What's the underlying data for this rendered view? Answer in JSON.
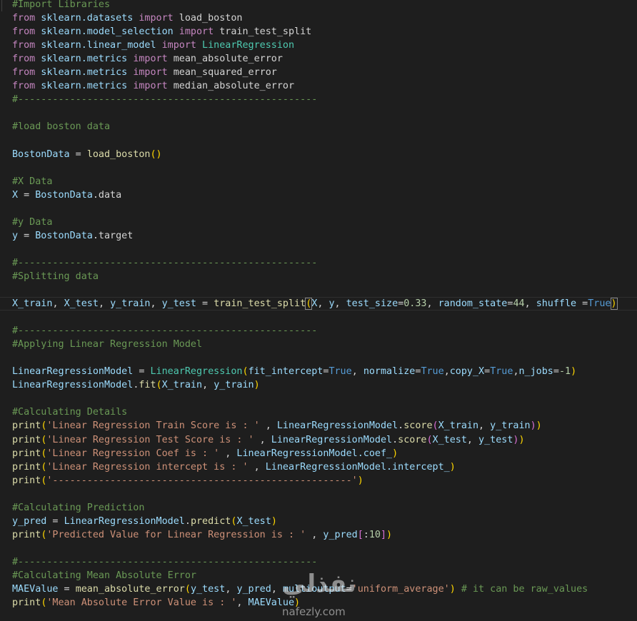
{
  "editor": {
    "lines": [
      [
        {
          "t": "#Import Libraries",
          "c": "comment"
        }
      ],
      [
        {
          "t": "from",
          "c": "kw"
        },
        {
          "t": " sklearn.datasets ",
          "c": "var"
        },
        {
          "t": "import",
          "c": "kw"
        },
        {
          "t": " load_boston",
          "c": "punc"
        }
      ],
      [
        {
          "t": "from",
          "c": "kw"
        },
        {
          "t": " sklearn.model_selection ",
          "c": "var"
        },
        {
          "t": "import",
          "c": "kw"
        },
        {
          "t": " train_test_split",
          "c": "punc"
        }
      ],
      [
        {
          "t": "from",
          "c": "kw"
        },
        {
          "t": " sklearn.linear_model ",
          "c": "var"
        },
        {
          "t": "import",
          "c": "kw"
        },
        {
          "t": " LinearRegression",
          "c": "type"
        }
      ],
      [
        {
          "t": "from",
          "c": "kw"
        },
        {
          "t": " sklearn.metrics ",
          "c": "var"
        },
        {
          "t": "import",
          "c": "kw"
        },
        {
          "t": " mean_absolute_error",
          "c": "punc"
        }
      ],
      [
        {
          "t": "from",
          "c": "kw"
        },
        {
          "t": " sklearn.metrics ",
          "c": "var"
        },
        {
          "t": "import",
          "c": "kw"
        },
        {
          "t": " mean_squared_error",
          "c": "punc"
        }
      ],
      [
        {
          "t": "from",
          "c": "kw"
        },
        {
          "t": " sklearn.metrics ",
          "c": "var"
        },
        {
          "t": "import",
          "c": "kw"
        },
        {
          "t": " median_absolute_error",
          "c": "punc"
        }
      ],
      [
        {
          "t": "#----------------------------------------------------",
          "c": "comment"
        }
      ],
      [],
      [
        {
          "t": "#load boston data",
          "c": "comment"
        }
      ],
      [],
      [
        {
          "t": "BostonData",
          "c": "var"
        },
        {
          "t": " = ",
          "c": "punc"
        },
        {
          "t": "load_boston",
          "c": "fn"
        },
        {
          "t": "()",
          "c": "paren"
        }
      ],
      [],
      [
        {
          "t": "#X Data",
          "c": "comment"
        }
      ],
      [
        {
          "t": "X",
          "c": "var"
        },
        {
          "t": " = ",
          "c": "punc"
        },
        {
          "t": "BostonData",
          "c": "var"
        },
        {
          "t": ".data",
          "c": "punc"
        }
      ],
      [],
      [
        {
          "t": "#y Data",
          "c": "comment"
        }
      ],
      [
        {
          "t": "y",
          "c": "var"
        },
        {
          "t": " = ",
          "c": "punc"
        },
        {
          "t": "BostonData",
          "c": "var"
        },
        {
          "t": ".target",
          "c": "punc"
        }
      ],
      [],
      [
        {
          "t": "#----------------------------------------------------",
          "c": "comment"
        }
      ],
      [
        {
          "t": "#Splitting data",
          "c": "comment"
        }
      ],
      [],
      [
        {
          "t": "X_train",
          "c": "var"
        },
        {
          "t": ", ",
          "c": "punc"
        },
        {
          "t": "X_test",
          "c": "var"
        },
        {
          "t": ", ",
          "c": "punc"
        },
        {
          "t": "y_train",
          "c": "var"
        },
        {
          "t": ", ",
          "c": "punc"
        },
        {
          "t": "y_test",
          "c": "var"
        },
        {
          "t": " = ",
          "c": "punc"
        },
        {
          "t": "train_test_split",
          "c": "fn"
        },
        {
          "t": "(",
          "c": "paren bracket-match"
        },
        {
          "t": "X",
          "c": "var"
        },
        {
          "t": ", ",
          "c": "punc"
        },
        {
          "t": "y",
          "c": "var"
        },
        {
          "t": ", ",
          "c": "punc"
        },
        {
          "t": "test_size",
          "c": "var"
        },
        {
          "t": "=",
          "c": "punc"
        },
        {
          "t": "0.33",
          "c": "num"
        },
        {
          "t": ", ",
          "c": "punc"
        },
        {
          "t": "random_state",
          "c": "var"
        },
        {
          "t": "=",
          "c": "punc"
        },
        {
          "t": "44",
          "c": "num"
        },
        {
          "t": ", ",
          "c": "punc"
        },
        {
          "t": "shuffle",
          "c": "var"
        },
        {
          "t": " =",
          "c": "punc"
        },
        {
          "t": "True",
          "c": "const"
        },
        {
          "t": ")",
          "c": "paren bracket-match"
        }
      ],
      [],
      [
        {
          "t": "#----------------------------------------------------",
          "c": "comment"
        }
      ],
      [
        {
          "t": "#Applying Linear Regression Model",
          "c": "comment"
        }
      ],
      [],
      [
        {
          "t": "LinearRegressionModel",
          "c": "var"
        },
        {
          "t": " = ",
          "c": "punc"
        },
        {
          "t": "LinearRegression",
          "c": "type"
        },
        {
          "t": "(",
          "c": "paren"
        },
        {
          "t": "fit_intercept",
          "c": "var"
        },
        {
          "t": "=",
          "c": "punc"
        },
        {
          "t": "True",
          "c": "const"
        },
        {
          "t": ", ",
          "c": "punc"
        },
        {
          "t": "normalize",
          "c": "var"
        },
        {
          "t": "=",
          "c": "punc"
        },
        {
          "t": "True",
          "c": "const"
        },
        {
          "t": ",",
          "c": "punc"
        },
        {
          "t": "copy_X",
          "c": "var"
        },
        {
          "t": "=",
          "c": "punc"
        },
        {
          "t": "True",
          "c": "const"
        },
        {
          "t": ",",
          "c": "punc"
        },
        {
          "t": "n_jobs",
          "c": "var"
        },
        {
          "t": "=",
          "c": "punc"
        },
        {
          "t": "-1",
          "c": "num"
        },
        {
          "t": ")",
          "c": "paren"
        }
      ],
      [
        {
          "t": "LinearRegressionModel",
          "c": "var"
        },
        {
          "t": ".",
          "c": "punc"
        },
        {
          "t": "fit",
          "c": "fn"
        },
        {
          "t": "(",
          "c": "paren"
        },
        {
          "t": "X_train",
          "c": "var"
        },
        {
          "t": ", ",
          "c": "punc"
        },
        {
          "t": "y_train",
          "c": "var"
        },
        {
          "t": ")",
          "c": "paren"
        }
      ],
      [],
      [
        {
          "t": "#Calculating Details",
          "c": "comment"
        }
      ],
      [
        {
          "t": "print",
          "c": "fn"
        },
        {
          "t": "(",
          "c": "paren"
        },
        {
          "t": "'Linear Regression Train Score is : '",
          "c": "str"
        },
        {
          "t": " , ",
          "c": "punc"
        },
        {
          "t": "LinearRegressionModel",
          "c": "var"
        },
        {
          "t": ".",
          "c": "punc"
        },
        {
          "t": "score",
          "c": "fn"
        },
        {
          "t": "(",
          "c": "paren2"
        },
        {
          "t": "X_train",
          "c": "var"
        },
        {
          "t": ", ",
          "c": "punc"
        },
        {
          "t": "y_train",
          "c": "var"
        },
        {
          "t": ")",
          "c": "paren2"
        },
        {
          "t": ")",
          "c": "paren"
        }
      ],
      [
        {
          "t": "print",
          "c": "fn"
        },
        {
          "t": "(",
          "c": "paren"
        },
        {
          "t": "'Linear Regression Test Score is : '",
          "c": "str"
        },
        {
          "t": " , ",
          "c": "punc"
        },
        {
          "t": "LinearRegressionModel",
          "c": "var"
        },
        {
          "t": ".",
          "c": "punc"
        },
        {
          "t": "score",
          "c": "fn"
        },
        {
          "t": "(",
          "c": "paren2"
        },
        {
          "t": "X_test",
          "c": "var"
        },
        {
          "t": ", ",
          "c": "punc"
        },
        {
          "t": "y_test",
          "c": "var"
        },
        {
          "t": ")",
          "c": "paren2"
        },
        {
          "t": ")",
          "c": "paren"
        }
      ],
      [
        {
          "t": "print",
          "c": "fn"
        },
        {
          "t": "(",
          "c": "paren"
        },
        {
          "t": "'Linear Regression Coef is : '",
          "c": "str"
        },
        {
          "t": " , ",
          "c": "punc"
        },
        {
          "t": "LinearRegressionModel",
          "c": "var"
        },
        {
          "t": ".coef_",
          "c": "var"
        },
        {
          "t": ")",
          "c": "paren"
        }
      ],
      [
        {
          "t": "print",
          "c": "fn"
        },
        {
          "t": "(",
          "c": "paren"
        },
        {
          "t": "'Linear Regression intercept is : '",
          "c": "str"
        },
        {
          "t": " , ",
          "c": "punc"
        },
        {
          "t": "LinearRegressionModel",
          "c": "var"
        },
        {
          "t": ".intercept_",
          "c": "var"
        },
        {
          "t": ")",
          "c": "paren"
        }
      ],
      [
        {
          "t": "print",
          "c": "fn"
        },
        {
          "t": "(",
          "c": "paren"
        },
        {
          "t": "'----------------------------------------------------'",
          "c": "str"
        },
        {
          "t": ")",
          "c": "paren"
        }
      ],
      [],
      [
        {
          "t": "#Calculating Prediction",
          "c": "comment"
        }
      ],
      [
        {
          "t": "y_pred",
          "c": "var"
        },
        {
          "t": " = ",
          "c": "punc"
        },
        {
          "t": "LinearRegressionModel",
          "c": "var"
        },
        {
          "t": ".",
          "c": "punc"
        },
        {
          "t": "predict",
          "c": "fn"
        },
        {
          "t": "(",
          "c": "paren"
        },
        {
          "t": "X_test",
          "c": "var"
        },
        {
          "t": ")",
          "c": "paren"
        }
      ],
      [
        {
          "t": "print",
          "c": "fn"
        },
        {
          "t": "(",
          "c": "paren"
        },
        {
          "t": "'Predicted Value for Linear Regression is : '",
          "c": "str"
        },
        {
          "t": " , ",
          "c": "punc"
        },
        {
          "t": "y_pred",
          "c": "var"
        },
        {
          "t": "[",
          "c": "paren2"
        },
        {
          "t": ":",
          "c": "punc"
        },
        {
          "t": "10",
          "c": "num"
        },
        {
          "t": "]",
          "c": "paren2"
        },
        {
          "t": ")",
          "c": "paren"
        }
      ],
      [],
      [
        {
          "t": "#----------------------------------------------------",
          "c": "comment"
        }
      ],
      [
        {
          "t": "#Calculating Mean Absolute Error",
          "c": "comment"
        }
      ],
      [
        {
          "t": "MAEValue",
          "c": "var"
        },
        {
          "t": " = ",
          "c": "punc"
        },
        {
          "t": "mean_absolute_error",
          "c": "fn"
        },
        {
          "t": "(",
          "c": "paren"
        },
        {
          "t": "y_test",
          "c": "var"
        },
        {
          "t": ", ",
          "c": "punc"
        },
        {
          "t": "y_pred",
          "c": "var"
        },
        {
          "t": ", ",
          "c": "punc"
        },
        {
          "t": "multioutput",
          "c": "var"
        },
        {
          "t": "=",
          "c": "punc"
        },
        {
          "t": "'uniform_average'",
          "c": "str"
        },
        {
          "t": ")",
          "c": "paren"
        },
        {
          "t": " # it can be raw_values",
          "c": "comment"
        }
      ],
      [
        {
          "t": "print",
          "c": "fn"
        },
        {
          "t": "(",
          "c": "paren"
        },
        {
          "t": "'Mean Absolute Error Value is : '",
          "c": "str"
        },
        {
          "t": ", ",
          "c": "punc"
        },
        {
          "t": "MAEValue",
          "c": "var"
        },
        {
          "t": ")",
          "c": "paren"
        }
      ]
    ],
    "highlighted_line": 22
  },
  "watermark": {
    "brand": "نفذلي",
    "site": "nafezly.com"
  }
}
